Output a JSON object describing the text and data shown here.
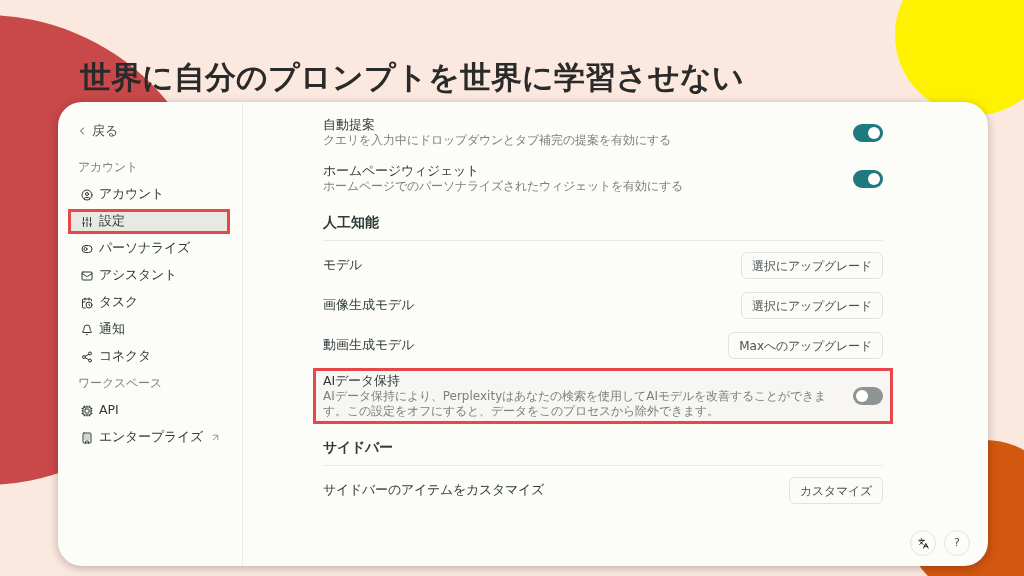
{
  "slide_title": "世界に自分のプロンプトを世界に学習させない",
  "sidebar": {
    "back_link": "戻る",
    "sections": [
      {
        "heading": "アカウント",
        "items": [
          {
            "label": "アカウント",
            "selected": false,
            "highlighted": false,
            "external": false
          },
          {
            "label": "設定",
            "selected": true,
            "highlighted": true,
            "external": false
          },
          {
            "label": "パーソナライズ",
            "selected": false,
            "highlighted": false,
            "external": false
          },
          {
            "label": "アシスタント",
            "selected": false,
            "highlighted": false,
            "external": false
          },
          {
            "label": "タスク",
            "selected": false,
            "highlighted": false,
            "external": false
          },
          {
            "label": "通知",
            "selected": false,
            "highlighted": false,
            "external": false
          },
          {
            "label": "コネクタ",
            "selected": false,
            "highlighted": false,
            "external": false
          }
        ]
      },
      {
        "heading": "ワークスペース",
        "items": [
          {
            "label": "API",
            "selected": false,
            "highlighted": false,
            "external": false
          },
          {
            "label": "エンタープライズ",
            "selected": false,
            "highlighted": false,
            "external": true
          }
        ]
      }
    ]
  },
  "settings": [
    {
      "kind": "toggle",
      "label": "自動提案",
      "description": "クエリを入力中にドロップダウンとタブ補完の提案を有効にする",
      "on": true,
      "highlighted": false
    },
    {
      "kind": "toggle",
      "label": "ホームページウィジェット",
      "description": "ホームページでのパーソナライズされたウィジェットを有効にする",
      "on": true,
      "highlighted": false
    },
    {
      "kind": "heading",
      "label": "人工知能"
    },
    {
      "kind": "button",
      "label": "モデル",
      "button": "選択にアップグレード",
      "highlighted": false
    },
    {
      "kind": "button",
      "label": "画像生成モデル",
      "button": "選択にアップグレード",
      "highlighted": false
    },
    {
      "kind": "button",
      "label": "動画生成モデル",
      "button": "Maxへのアップグレード",
      "highlighted": false
    },
    {
      "kind": "toggle",
      "label": "AIデータ保持",
      "description": "AIデータ保持により、Perplexityはあなたの検索を使用してAIモデルを改善することができます。この設定をオフにすると、データをこのプロセスから除外できます。",
      "on": false,
      "highlighted": true
    },
    {
      "kind": "heading",
      "label": "サイドバー"
    },
    {
      "kind": "button",
      "label": "サイドバーのアイテムをカスタマイズ",
      "button": "カスタマイズ",
      "highlighted": false
    }
  ],
  "help_button": "?"
}
